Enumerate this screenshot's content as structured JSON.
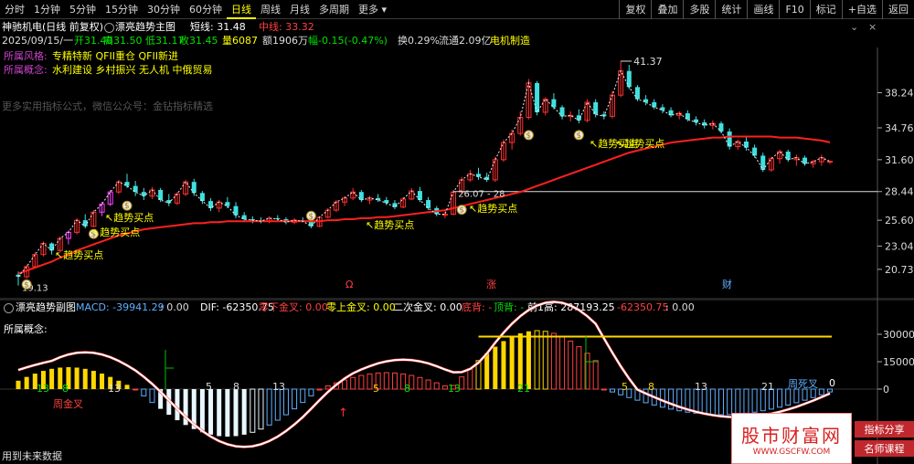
{
  "toolbar": {
    "periods": [
      "分时",
      "1分钟",
      "5分钟",
      "15分钟",
      "30分钟",
      "60分钟",
      "日线",
      "周线",
      "月线",
      "多周期",
      "更多"
    ],
    "active_period": "日线",
    "right_buttons": [
      "复权",
      "叠加",
      "多股",
      "统计",
      "画线",
      "F10",
      "标记",
      "+自选",
      "返回"
    ]
  },
  "title": {
    "stock": "神驰机电(日线 前复权)",
    "indicator": "漂亮趋势主图",
    "short_label": "短线: 31.48",
    "mid_label": "中线: 33.32"
  },
  "info": {
    "date": "2025/09/15/一",
    "open": "开31.40",
    "high": "高31.50",
    "low": "低31.17",
    "close": "收31.45",
    "volume": "量6087",
    "amount": "额1906万",
    "change": "幅-0.15(-0.47%)",
    "turnover": "换0.29%",
    "float": "流通2.09亿",
    "industry": "电机制造"
  },
  "style": {
    "label": "所属风格:",
    "value": "专精特新 QFII重仓 QFII新进"
  },
  "concept": {
    "label": "所属概念:",
    "value": "水利建设 乡村振兴 无人机 中俄贸易"
  },
  "watermark_text": "更多实用指标公式，微信公众号：金钻指标精选",
  "price_axis": [
    "38.24",
    "34.76",
    "31.60",
    "28.44",
    "25.60",
    "23.04",
    "20.73"
  ],
  "annotations": {
    "high_price": "41.37",
    "low_price": "19.13",
    "mid_price": "26.07 - 28",
    "buy_signal": "趋势买点",
    "event_rise": "涨",
    "event_fin": "财",
    "event_flag": "Ω"
  },
  "sub": {
    "title": "漂亮趋势副图",
    "macd": "MACD: -39941.29",
    "macd_zero": ": 0.00",
    "dif": "DIF: -62350.75",
    "zero_down_cross": "零下金叉: 0.00",
    "zero_up_cross": "零上金叉: 0.00",
    "second_cross": "二次金叉: 0.00",
    "bottom_div": "底背: -",
    "top_div": "顶背: -",
    "prev_high": "前1高: 287193.25",
    "prev_dif": "-62350.75",
    "prev_zero": ": 0.00",
    "concept_label": "所属概念:",
    "axis": [
      "30000",
      "15000",
      "0"
    ],
    "week_golden": "周金叉",
    "week_dead": "周死叉",
    "future_data": "用到未来数据",
    "fib": [
      "13",
      "8",
      "13",
      "5",
      "8",
      "13",
      "5",
      "8",
      "13",
      "21",
      "5",
      "8",
      "13",
      "21",
      "0"
    ]
  },
  "watermark_ad": {
    "cn": "股市财富网",
    "url": "WWW.GSCFW.COM",
    "tag1": "指标分享",
    "tag2": "名师课程"
  },
  "chart_data": {
    "type": "candlestick",
    "ylim": [
      19.0,
      42.0
    ],
    "candles": [
      [
        20.2,
        20.5,
        19.13,
        20.0
      ],
      [
        20.0,
        21.2,
        19.8,
        21.0
      ],
      [
        21.0,
        22.4,
        20.9,
        22.2
      ],
      [
        22.2,
        23.5,
        22.0,
        23.3
      ],
      [
        23.3,
        23.4,
        22.2,
        22.6
      ],
      [
        22.6,
        24.0,
        22.4,
        23.8
      ],
      [
        23.8,
        24.6,
        23.2,
        24.4
      ],
      [
        24.4,
        25.8,
        24.2,
        25.6
      ],
      [
        25.6,
        26.2,
        24.8,
        25.0
      ],
      [
        25.0,
        26.6,
        24.9,
        26.4
      ],
      [
        26.4,
        27.4,
        26.0,
        27.2
      ],
      [
        27.2,
        28.6,
        27.0,
        28.4
      ],
      [
        28.4,
        29.6,
        28.2,
        29.4
      ],
      [
        29.4,
        30.2,
        28.8,
        29.0
      ],
      [
        29.0,
        29.5,
        28.0,
        28.4
      ],
      [
        28.4,
        28.8,
        27.6,
        28.0
      ],
      [
        28.0,
        28.9,
        27.7,
        28.6
      ],
      [
        28.6,
        28.8,
        27.4,
        27.6
      ],
      [
        27.6,
        28.2,
        27.0,
        27.3
      ],
      [
        27.3,
        28.4,
        27.1,
        28.2
      ],
      [
        28.2,
        29.6,
        28.0,
        29.4
      ],
      [
        29.4,
        29.7,
        28.0,
        28.3
      ],
      [
        28.3,
        28.5,
        27.2,
        27.5
      ],
      [
        27.5,
        27.8,
        26.5,
        26.8
      ],
      [
        26.8,
        27.6,
        26.4,
        27.4
      ],
      [
        27.4,
        27.9,
        26.8,
        27.0
      ],
      [
        27.0,
        27.4,
        25.8,
        26.1
      ],
      [
        26.1,
        26.4,
        25.4,
        25.7
      ],
      [
        25.7,
        26.0,
        25.3,
        25.6
      ],
      [
        25.6,
        25.9,
        25.3,
        25.5
      ],
      [
        25.5,
        26.0,
        25.3,
        25.8
      ],
      [
        25.8,
        26.1,
        25.5,
        25.7
      ],
      [
        25.7,
        25.9,
        25.2,
        25.4
      ],
      [
        25.4,
        25.8,
        25.2,
        25.6
      ],
      [
        25.6,
        25.9,
        25.4,
        25.5
      ],
      [
        25.5,
        25.8,
        24.8,
        25.0
      ],
      [
        25.0,
        26.0,
        24.9,
        25.9
      ],
      [
        25.9,
        26.8,
        25.8,
        26.6
      ],
      [
        26.6,
        27.6,
        26.4,
        27.4
      ],
      [
        27.4,
        28.0,
        27.0,
        27.8
      ],
      [
        27.8,
        28.8,
        27.6,
        28.4
      ],
      [
        28.4,
        28.6,
        27.4,
        27.6
      ],
      [
        27.6,
        28.0,
        27.2,
        27.8
      ],
      [
        27.8,
        28.2,
        27.4,
        27.6
      ],
      [
        27.6,
        27.9,
        27.1,
        27.3
      ],
      [
        27.3,
        27.6,
        26.7,
        26.9
      ],
      [
        26.9,
        27.9,
        26.8,
        27.7
      ],
      [
        27.7,
        28.8,
        27.6,
        28.5
      ],
      [
        28.5,
        28.9,
        27.4,
        27.6
      ],
      [
        27.6,
        27.9,
        26.6,
        26.8
      ],
      [
        26.8,
        27.0,
        26.0,
        26.2
      ],
      [
        26.2,
        26.5,
        25.8,
        26.2
      ],
      [
        26.2,
        28.6,
        26.1,
        28.4
      ],
      [
        28.4,
        29.9,
        28.2,
        29.6
      ],
      [
        29.6,
        30.6,
        29.4,
        30.2
      ],
      [
        30.2,
        30.8,
        29.6,
        29.9
      ],
      [
        29.9,
        30.3,
        29.4,
        29.6
      ],
      [
        29.6,
        31.9,
        29.4,
        31.6
      ],
      [
        31.6,
        33.6,
        31.4,
        33.3
      ],
      [
        33.3,
        34.6,
        32.6,
        34.2
      ],
      [
        34.2,
        36.4,
        34.0,
        35.8
      ],
      [
        35.8,
        39.6,
        35.6,
        39.2
      ],
      [
        39.2,
        39.4,
        36.0,
        36.3
      ],
      [
        36.3,
        37.8,
        36.0,
        37.6
      ],
      [
        37.6,
        38.2,
        36.6,
        36.8
      ],
      [
        36.8,
        37.0,
        35.6,
        35.9
      ],
      [
        35.9,
        36.4,
        35.4,
        36.0
      ],
      [
        36.0,
        36.6,
        35.2,
        35.5
      ],
      [
        35.5,
        37.6,
        35.3,
        37.3
      ],
      [
        37.3,
        37.6,
        35.8,
        36.1
      ],
      [
        36.1,
        36.4,
        35.6,
        35.9
      ],
      [
        35.9,
        38.4,
        35.7,
        38.0
      ],
      [
        38.0,
        41.37,
        37.8,
        40.4
      ],
      [
        40.4,
        41.0,
        38.6,
        38.8
      ],
      [
        38.8,
        39.0,
        37.4,
        37.6
      ],
      [
        37.6,
        38.0,
        37.0,
        37.3
      ],
      [
        37.3,
        37.6,
        36.6,
        36.8
      ],
      [
        36.8,
        37.1,
        36.2,
        36.5
      ],
      [
        36.5,
        36.8,
        35.8,
        36.0
      ],
      [
        36.0,
        36.4,
        35.6,
        36.2
      ],
      [
        36.2,
        36.5,
        35.4,
        35.6
      ],
      [
        35.6,
        35.9,
        35.0,
        35.3
      ],
      [
        35.3,
        35.6,
        34.7,
        35.0
      ],
      [
        35.0,
        35.5,
        34.6,
        35.2
      ],
      [
        35.2,
        35.4,
        34.2,
        34.4
      ],
      [
        34.4,
        34.7,
        32.6,
        32.9
      ],
      [
        32.9,
        33.6,
        32.6,
        33.4
      ],
      [
        33.4,
        33.8,
        32.5,
        32.8
      ],
      [
        32.8,
        33.1,
        31.8,
        32.0
      ],
      [
        32.0,
        32.3,
        30.4,
        30.6
      ],
      [
        30.6,
        31.9,
        30.4,
        31.7
      ],
      [
        31.7,
        32.6,
        31.2,
        32.4
      ],
      [
        32.4,
        32.6,
        31.4,
        31.6
      ],
      [
        31.6,
        32.1,
        31.0,
        31.8
      ],
      [
        31.8,
        32.0,
        31.0,
        31.2
      ],
      [
        31.2,
        31.6,
        30.8,
        31.4
      ],
      [
        31.4,
        32.1,
        31.0,
        31.8
      ],
      [
        31.4,
        31.5,
        31.17,
        31.45
      ]
    ],
    "mid_line": [
      20.3,
      20.6,
      20.9,
      21.2,
      21.5,
      21.9,
      22.2,
      22.6,
      22.9,
      23.2,
      23.5,
      23.8,
      24.1,
      24.3,
      24.5,
      24.7,
      24.8,
      24.9,
      25.0,
      25.1,
      25.2,
      25.3,
      25.3,
      25.4,
      25.4,
      25.5,
      25.5,
      25.5,
      25.5,
      25.5,
      25.5,
      25.5,
      25.5,
      25.5,
      25.5,
      25.5,
      25.5,
      25.6,
      25.6,
      25.7,
      25.7,
      25.8,
      25.8,
      25.9,
      25.9,
      26.0,
      26.1,
      26.2,
      26.3,
      26.4,
      26.5,
      26.6,
      26.8,
      27.0,
      27.2,
      27.4,
      27.6,
      27.8,
      28.0,
      28.2,
      28.4,
      28.7,
      29.0,
      29.3,
      29.6,
      29.9,
      30.2,
      30.5,
      30.8,
      31.1,
      31.4,
      31.7,
      32.0,
      32.3,
      32.5,
      32.7,
      32.9,
      33.1,
      33.3,
      33.4,
      33.5,
      33.6,
      33.7,
      33.8,
      33.8,
      33.9,
      33.9,
      33.9,
      33.9,
      33.9,
      33.9,
      33.8,
      33.8,
      33.8,
      33.7,
      33.6,
      33.5,
      33.32
    ],
    "signal_line": 28.44
  }
}
